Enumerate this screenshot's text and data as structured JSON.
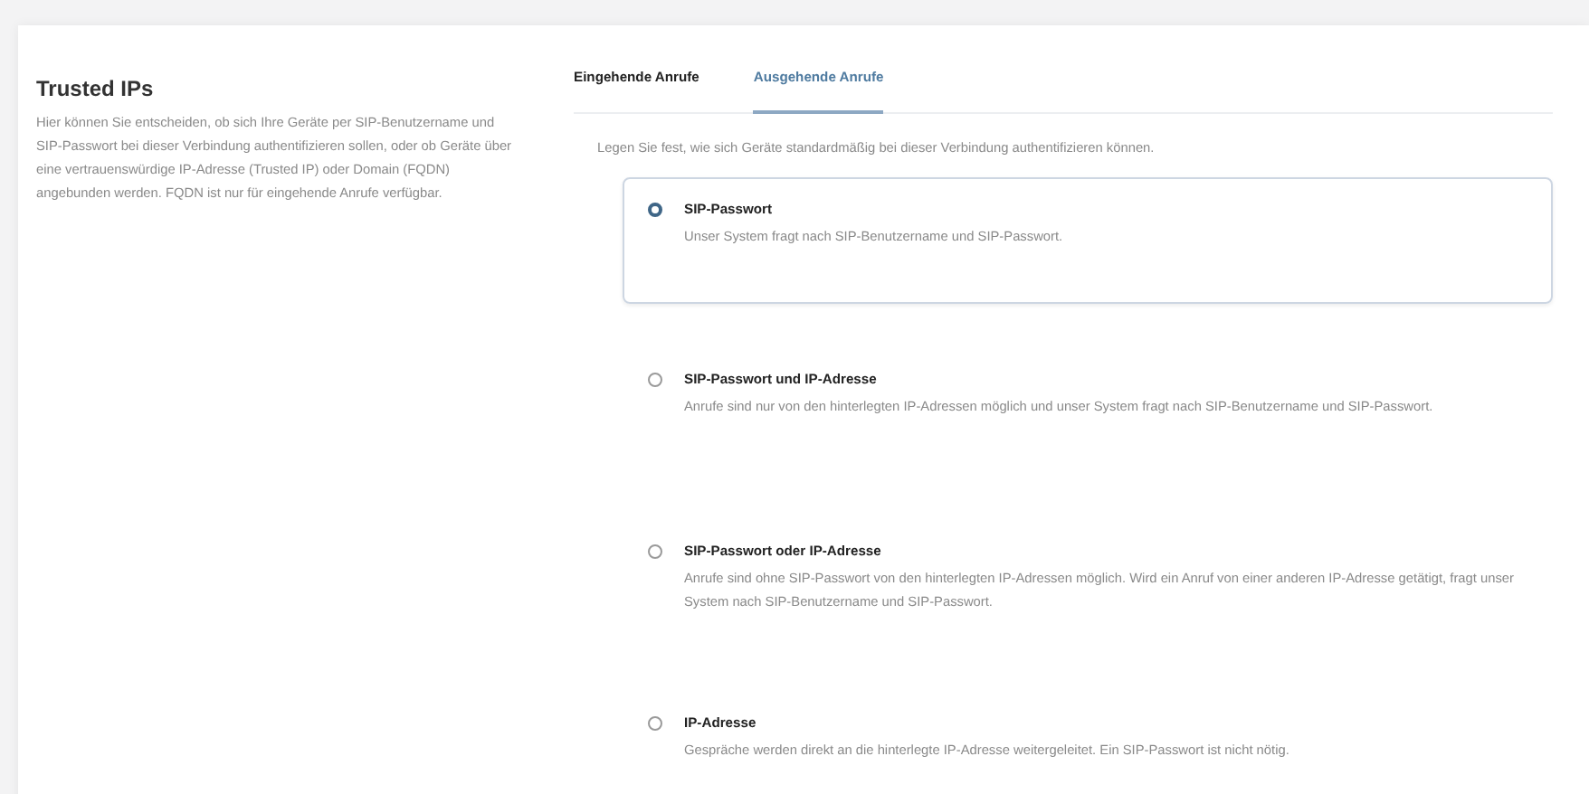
{
  "section": {
    "title": "Trusted IPs",
    "description": "Hier können Sie entscheiden, ob sich Ihre Geräte per SIP-Benutzername und SIP-Passwort bei dieser Verbindung authentifizieren sollen, oder ob Geräte über eine vertrauenswürdige IP-Adresse (Trusted IP) oder Domain (FQDN) angebunden werden. FQDN ist nur für eingehende Anrufe verfügbar."
  },
  "tabs": [
    {
      "label": "Eingehende Anrufe",
      "selected": false
    },
    {
      "label": "Ausgehende Anrufe",
      "selected": true
    }
  ],
  "intro": "Legen Sie fest, wie sich Geräte standardmäßig bei dieser Verbindung authentifizieren können.",
  "options": [
    {
      "title": "SIP-Passwort",
      "description": "Unser System fragt nach SIP-Benutzername und SIP-Passwort.",
      "selected": true
    },
    {
      "title": "SIP-Passwort und IP-Adresse",
      "description": "Anrufe sind nur von den hinterlegten IP-Adressen möglich und unser System fragt nach SIP-Benutzername und SIP-Passwort.",
      "selected": false
    },
    {
      "title": "SIP-Passwort oder IP-Adresse",
      "description": "Anrufe sind ohne SIP-Passwort von den hinterlegten IP-Adressen möglich. Wird ein Anruf von einer anderen IP-Adresse getätigt, fragt unser System nach SIP-Benutzername und SIP-Passwort.",
      "selected": false
    },
    {
      "title": "IP-Adresse",
      "description": "Gespräche werden direkt an die hinterlegte IP-Adresse weitergeleitet. Ein SIP-Passwort ist nicht nötig.",
      "selected": false
    }
  ]
}
